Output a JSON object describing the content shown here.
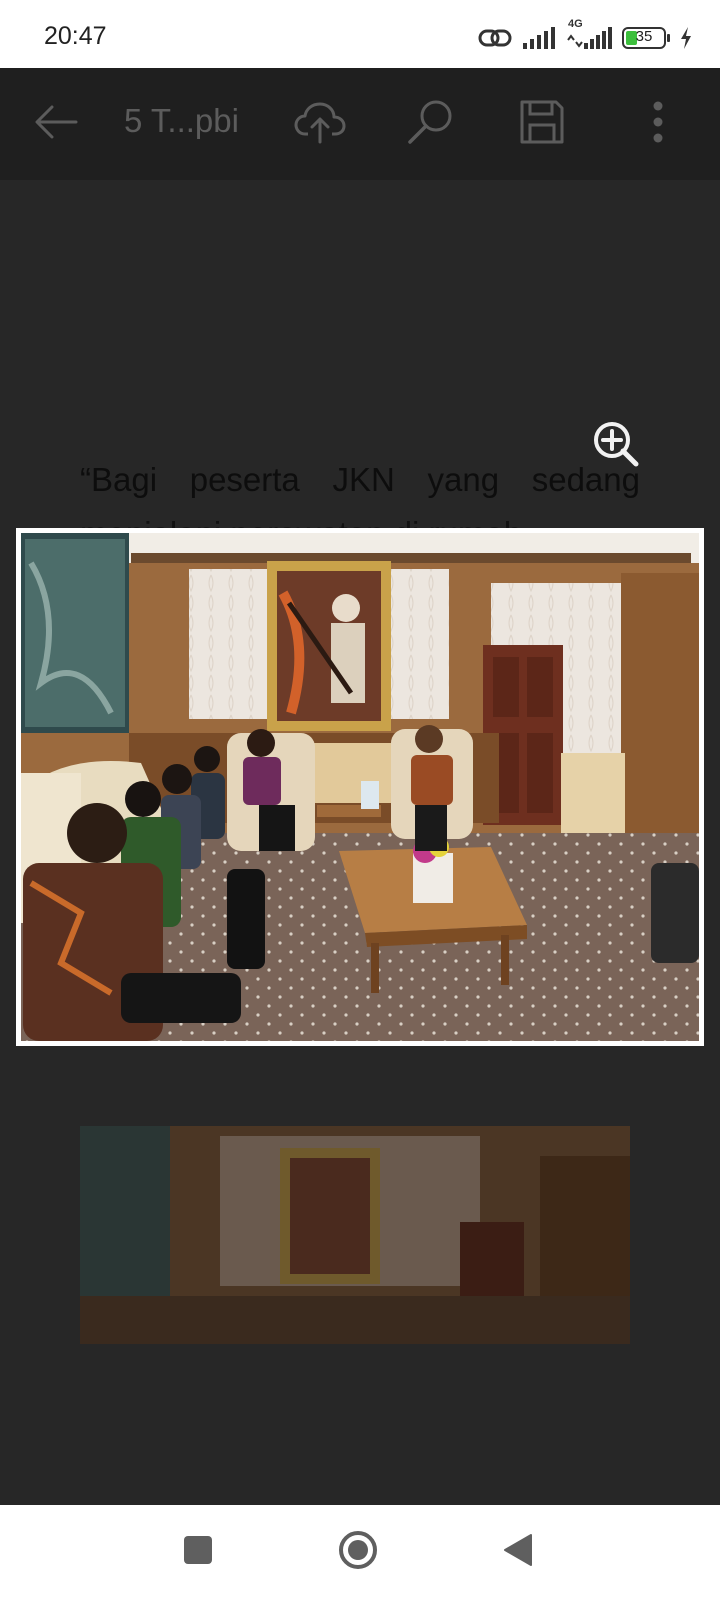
{
  "status_bar": {
    "time": "20:47",
    "network_label": "4G",
    "battery_level": "35",
    "icons": [
      "link-icon",
      "signal-icon",
      "signal-4g-icon",
      "battery-icon",
      "charging-icon"
    ]
  },
  "toolbar": {
    "title": "5 T...pbi",
    "icons": [
      "back-arrow-icon",
      "cloud-upload-icon",
      "search-icon",
      "save-icon",
      "more-vert-icon"
    ]
  },
  "document": {
    "paragraph_line1": "“Bagi peserta JKN yang sedang",
    "paragraph_line2": "menjalani perawatan di rumah",
    "zoom_icon": "zoom-in-icon"
  },
  "navigation": {
    "icons": [
      "recents-square-icon",
      "home-circle-icon",
      "back-triangle-icon"
    ]
  },
  "colors": {
    "page_background": "#272727",
    "toolbar_background": "#1f1f1f",
    "status_bar": "#ffffff",
    "battery_green": "#3cbf3c"
  }
}
